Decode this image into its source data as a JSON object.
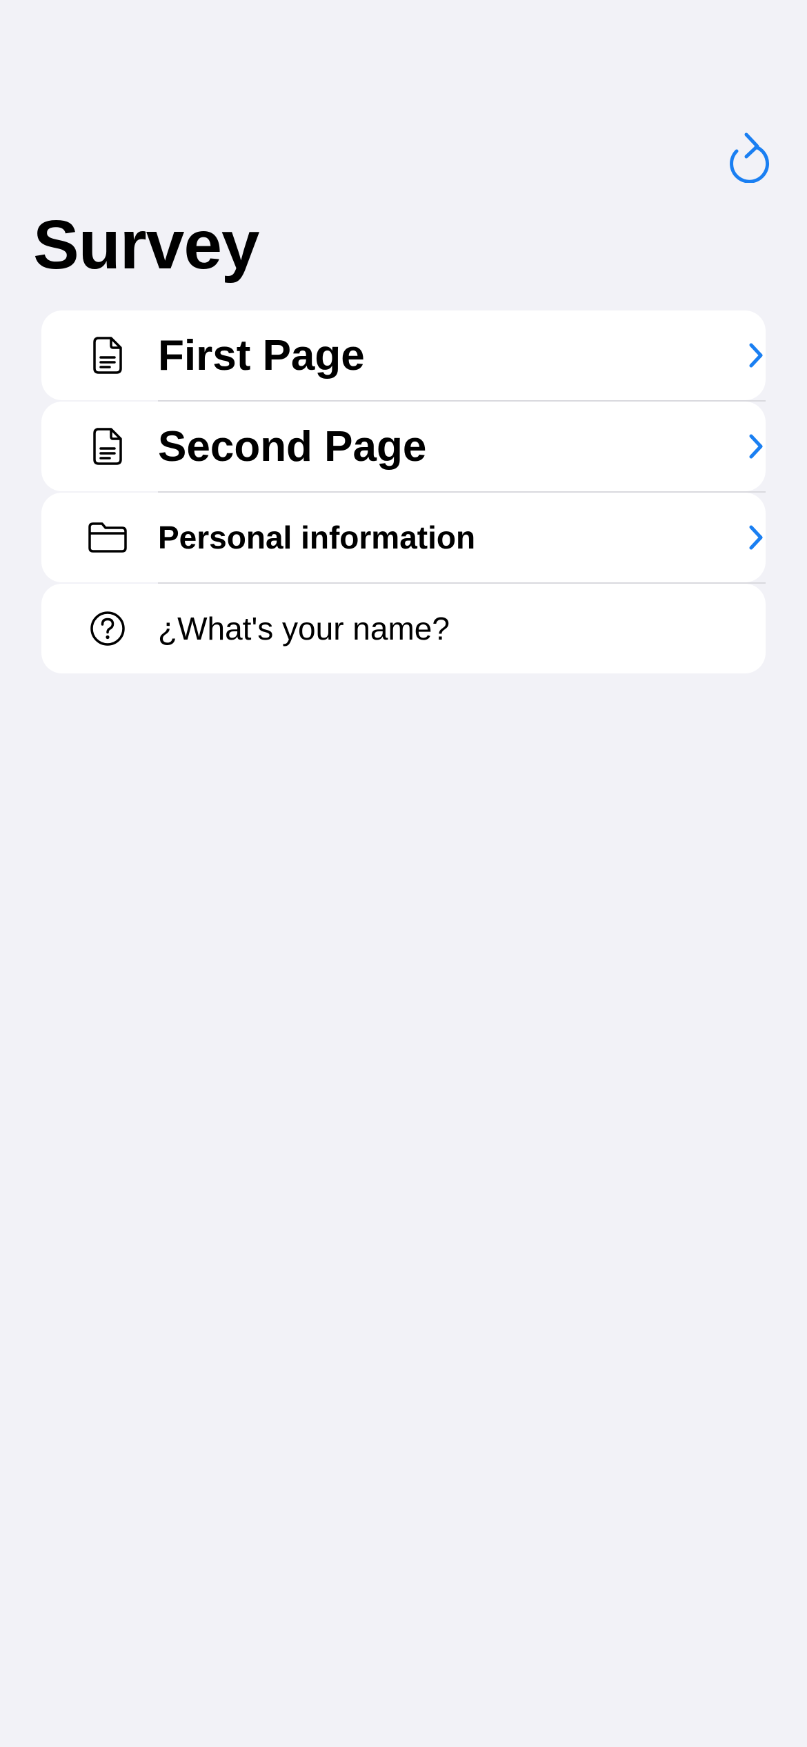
{
  "nav": {
    "refresh_icon": "arrow-clockwise-icon"
  },
  "header": {
    "title": "Survey"
  },
  "colors": {
    "accent": "#1a7ff2",
    "background": "#f2f2f7",
    "card": "#ffffff",
    "separator": "#d9d9de"
  },
  "list": {
    "items": [
      {
        "label": "First Page",
        "icon": "document-icon",
        "disclosure": true
      },
      {
        "label": "Second Page",
        "icon": "document-icon",
        "disclosure": true
      },
      {
        "label": "Personal information",
        "icon": "folder-icon",
        "disclosure": true
      },
      {
        "label": "¿What's your name?",
        "icon": "question-circle-icon",
        "disclosure": false
      }
    ]
  }
}
